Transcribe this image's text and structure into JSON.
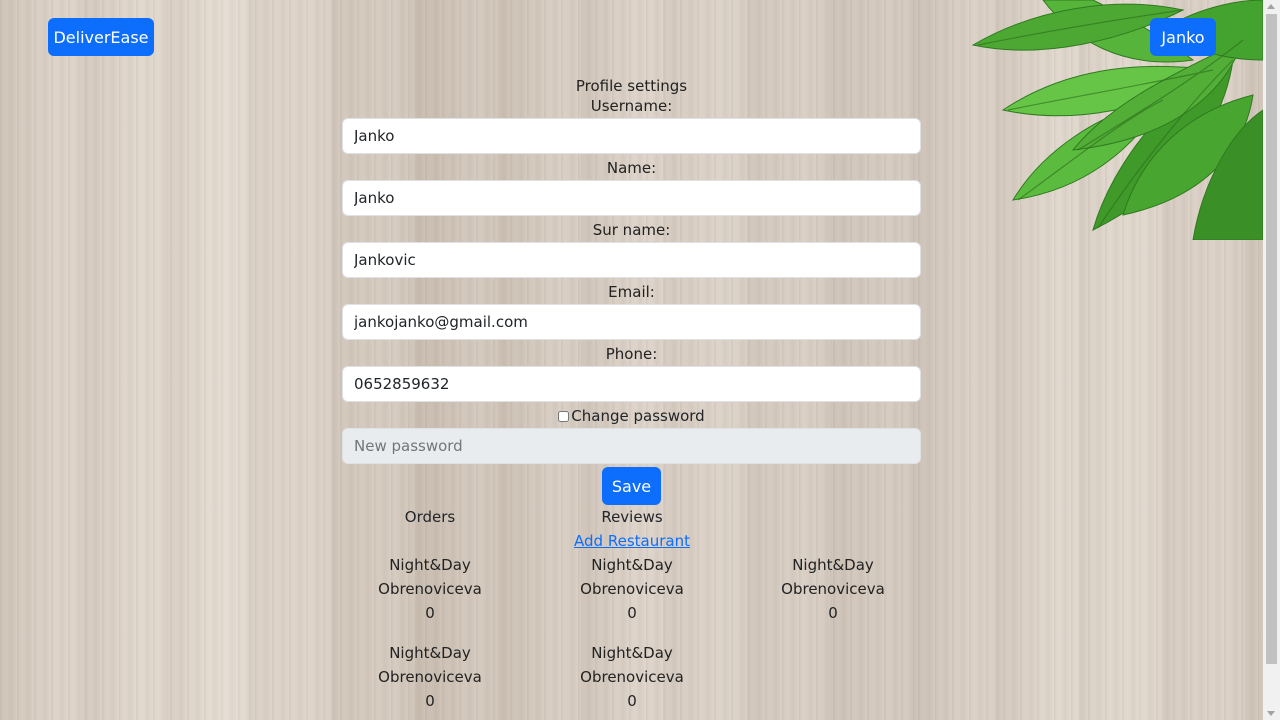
{
  "nav": {
    "brand": "DeliverEase",
    "user": "Janko"
  },
  "profile": {
    "title": "Profile settings",
    "username_label": "Username:",
    "username_value": "Janko",
    "name_label": "Name:",
    "name_value": "Janko",
    "surname_label": "Sur name:",
    "surname_value": "Jankovic",
    "email_label": "Email:",
    "email_value": "jankojanko@gmail.com",
    "phone_label": "Phone:",
    "phone_value": "0652859632",
    "change_password_label": "Change password",
    "new_password_placeholder": "New password",
    "save_label": "Save"
  },
  "sections": {
    "orders": "Orders",
    "reviews": "Reviews",
    "add_restaurant": "Add Restaurant"
  },
  "restaurants": [
    {
      "name": "Night&Day",
      "address": "Obrenoviceva",
      "count": "0"
    },
    {
      "name": "Night&Day",
      "address": "Obrenoviceva",
      "count": "0"
    },
    {
      "name": "Night&Day",
      "address": "Obrenoviceva",
      "count": "0"
    },
    {
      "name": "Night&Day",
      "address": "Obrenoviceva",
      "count": "0"
    },
    {
      "name": "Night&Day",
      "address": "Obrenoviceva",
      "count": "0"
    }
  ]
}
